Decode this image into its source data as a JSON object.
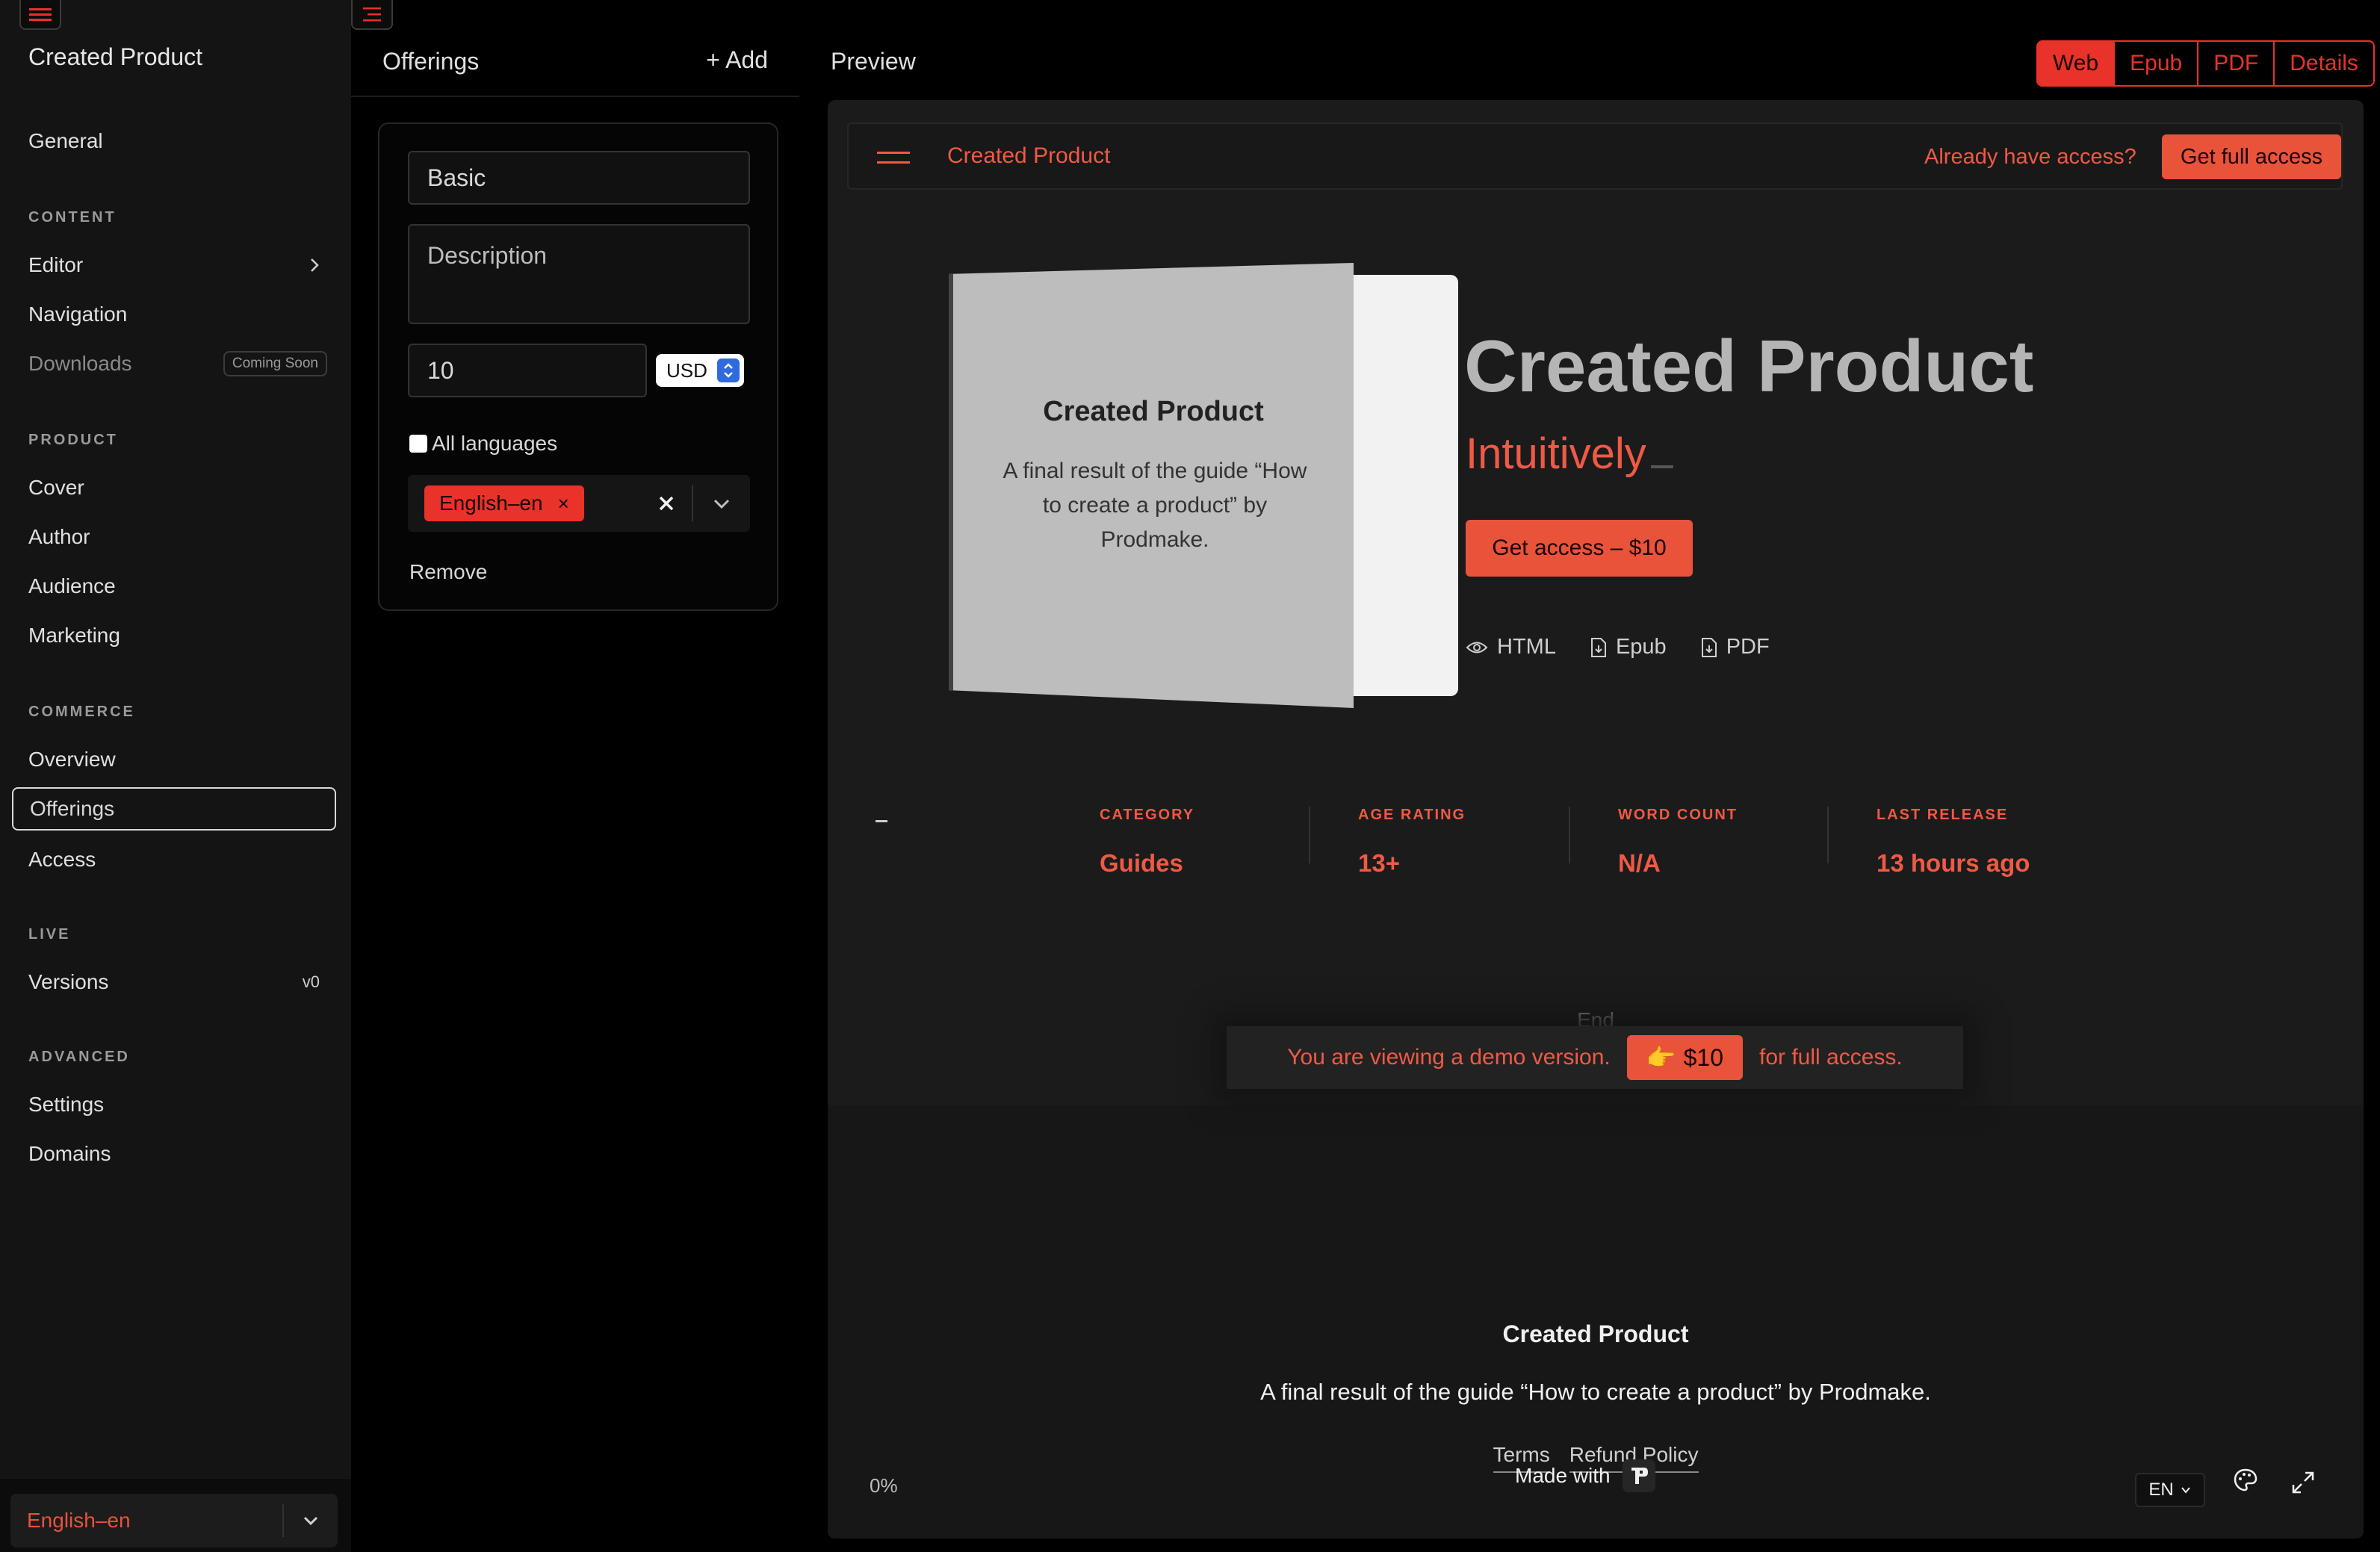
{
  "sidebar": {
    "title": "Created Product",
    "general": "General",
    "sections": {
      "content": "CONTENT",
      "product": "PRODUCT",
      "commerce": "COMMERCE",
      "live": "LIVE",
      "advanced": "ADVANCED"
    },
    "items": {
      "editor": "Editor",
      "navigation": "Navigation",
      "downloads": "Downloads",
      "downloads_badge": "Coming Soon",
      "cover": "Cover",
      "author": "Author",
      "audience": "Audience",
      "marketing": "Marketing",
      "overview": "Overview",
      "offerings": "Offerings",
      "access": "Access",
      "versions": "Versions",
      "versions_tag": "v0",
      "settings": "Settings",
      "domains": "Domains"
    },
    "language": "English–en"
  },
  "offerings": {
    "title": "Offerings",
    "add_label": "+ Add",
    "name_value": "Basic",
    "description_placeholder": "Description",
    "price_value": "10",
    "currency": "USD",
    "all_languages_label": "All languages",
    "language_chip": "English–en",
    "chip_remove": "×",
    "remove_label": "Remove"
  },
  "preview": {
    "title": "Preview",
    "tabs": [
      "Web",
      "Epub",
      "PDF",
      "Details"
    ],
    "active_tab": "Web",
    "topbar": {
      "brand": "Created Product",
      "already": "Already have access?",
      "get_full": "Get full access"
    },
    "book": {
      "title": "Created Product",
      "subtitle": "A final result of the guide “How to create a product” by Prodmake."
    },
    "hero": {
      "title": "Created Product",
      "tagline": "Intuitively",
      "cta": "Get access – $10"
    },
    "formats": [
      "HTML",
      "Epub",
      "PDF"
    ],
    "stats": [
      {
        "label": "CATEGORY",
        "value": "Guides"
      },
      {
        "label": "AGE RATING",
        "value": "13+"
      },
      {
        "label": "WORD COUNT",
        "value": "N/A"
      },
      {
        "label": "LAST RELEASE",
        "value": "13 hours ago"
      }
    ],
    "end_text": "End",
    "demo": {
      "before": "You are viewing a demo version.",
      "button": "$10",
      "after": "for full access."
    },
    "footer": {
      "title": "Created Product",
      "subtitle": "A final result of the guide “How to create a product” by Prodmake.",
      "links": [
        "Terms",
        "Refund Policy"
      ],
      "made_with": "Made with",
      "progress": "0%",
      "lang": "EN"
    }
  },
  "colors": {
    "accent": "#e8533a",
    "accent_text": "#ef5a45",
    "background": "#000000",
    "sidebar_bg": "#141414",
    "preview_bg": "#1b1b1b"
  }
}
